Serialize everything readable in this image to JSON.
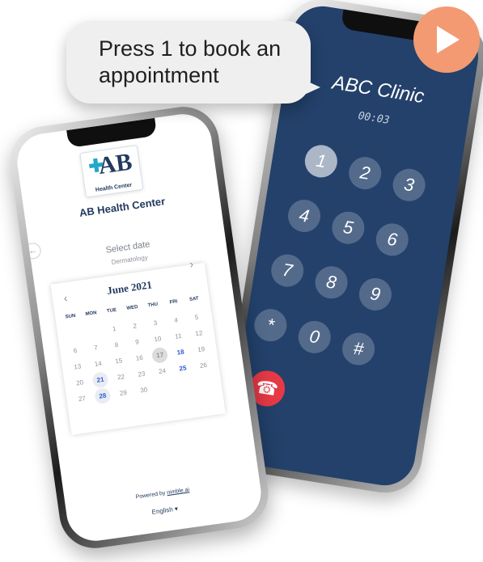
{
  "speech_bubble": {
    "text": "Press 1 to book an appointment"
  },
  "call_screen": {
    "clinic": "ABC Clinic",
    "timer": "00:03",
    "keys": [
      "1",
      "2",
      "3",
      "4",
      "5",
      "6",
      "7",
      "8",
      "9",
      "*",
      "0",
      "#"
    ],
    "pressed_key": "1",
    "end_call_icon": "phone-hangup-icon"
  },
  "booking_screen": {
    "logo": {
      "main": "AB",
      "sub": "Health Center"
    },
    "center_name": "AB Health Center",
    "select_date": "Select date",
    "department": "Dermatology",
    "calendar": {
      "month": "June 2021",
      "weekdays": [
        "SUN",
        "MON",
        "TUE",
        "WED",
        "THU",
        "FRI",
        "SAT"
      ],
      "leading_blanks": 2,
      "days": [
        "1",
        "2",
        "3",
        "4",
        "5",
        "6",
        "7",
        "8",
        "9",
        "10",
        "11",
        "12",
        "13",
        "14",
        "15",
        "16",
        "17",
        "18",
        "19",
        "20",
        "21",
        "22",
        "23",
        "24",
        "25",
        "26",
        "27",
        "28",
        "29",
        "30"
      ],
      "today": "17",
      "selected": [
        "21",
        "28"
      ],
      "available": [
        "18",
        "25"
      ]
    },
    "powered_by_prefix": "Powered by ",
    "powered_by_link": "nimble.ai",
    "language": "English ▾"
  },
  "colors": {
    "call_bg": "#23416b",
    "brand_navy": "#223a5e",
    "end_call": "#e63946",
    "play": "#f39a72",
    "accent_blue": "#2d5ad1"
  }
}
